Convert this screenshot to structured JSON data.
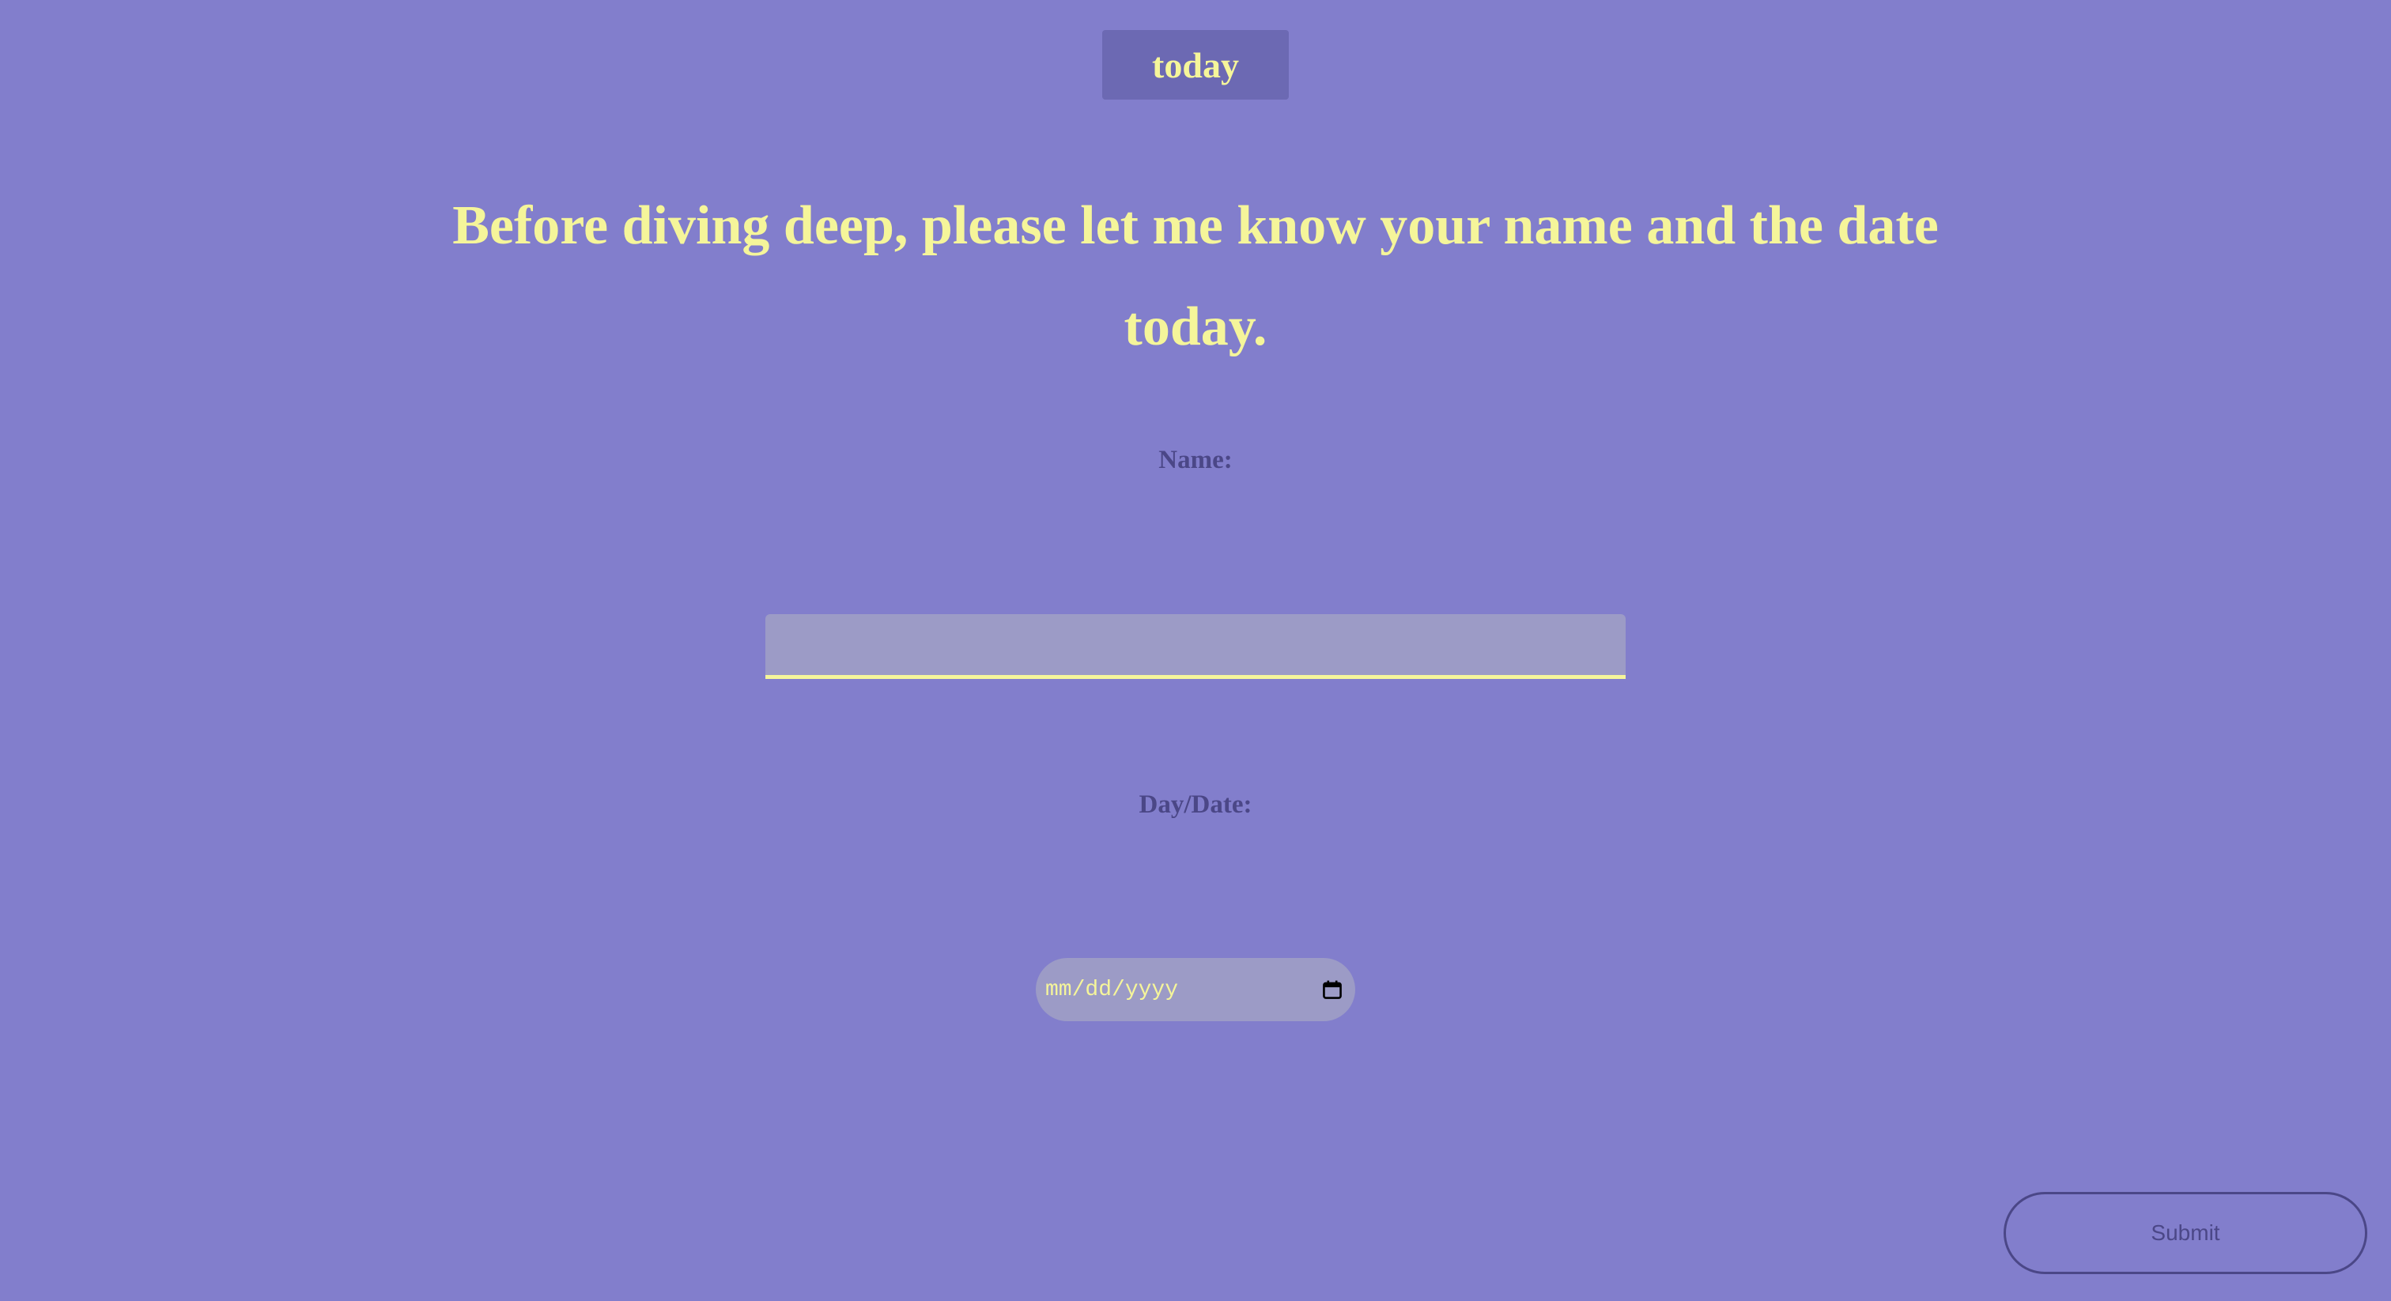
{
  "nav": {
    "today_label": "today"
  },
  "main": {
    "headline": "Before diving deep, please let me know your name and the date today.",
    "name_label": "Name:",
    "name_value": "",
    "date_label": "Day/Date:",
    "date_placeholder": "mm/dd/yyyy"
  },
  "actions": {
    "submit_label": "Submit"
  },
  "icons": {
    "date_picker": "calendar-icon"
  },
  "colors": {
    "background": "#827ecc",
    "accent_text": "#f5f59a",
    "label_text": "#4b4787",
    "input_fill": "#9c9bc6",
    "badge_fill": "#6c69b3"
  }
}
